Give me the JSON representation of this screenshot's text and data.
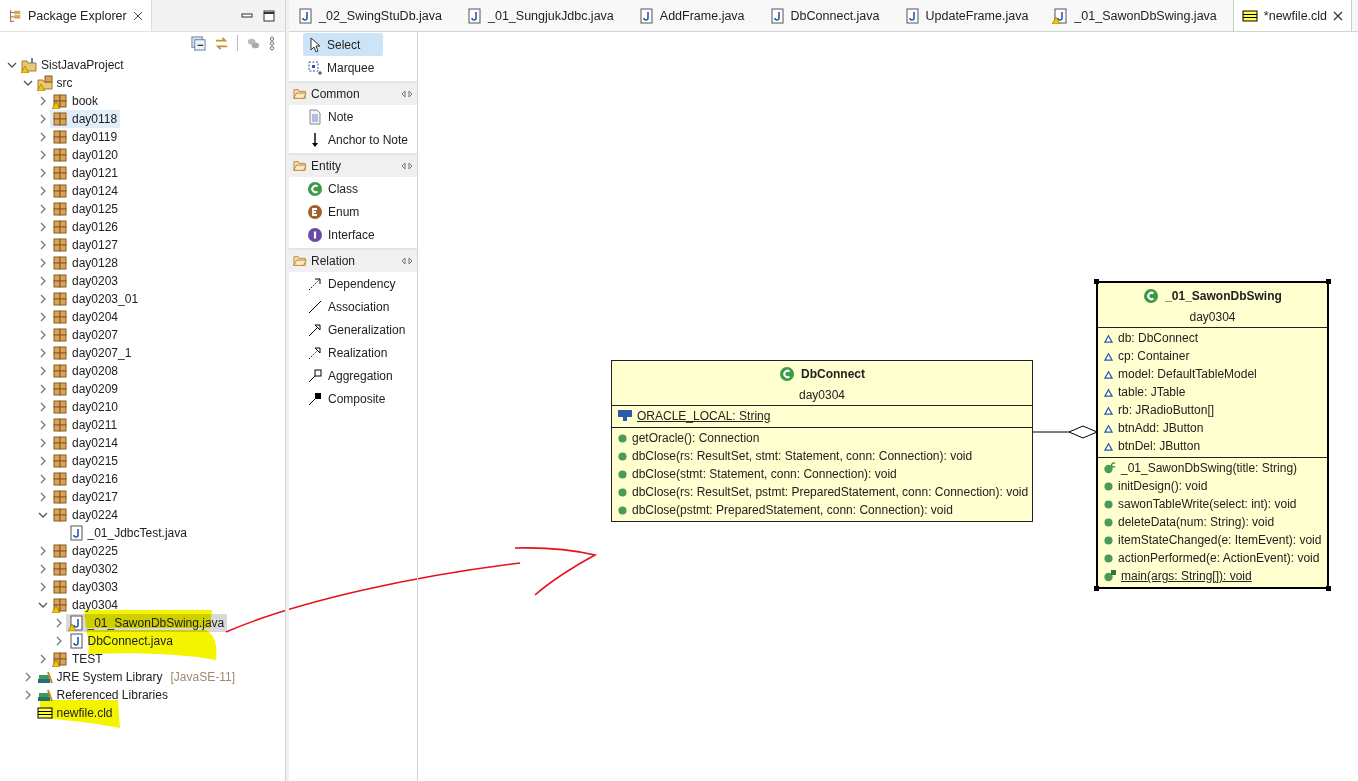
{
  "explorer": {
    "title": "Package Explorer",
    "tree": [
      {
        "label": "SistJavaProject",
        "kind": "project",
        "warning": true,
        "expanded": true,
        "selected": false,
        "hovered": false,
        "children": [
          {
            "label": "src",
            "kind": "source-folder",
            "warning": true,
            "expanded": true,
            "selected": false,
            "hovered": false,
            "children": [
              {
                "label": "book",
                "kind": "package",
                "warning": true,
                "expanded": false,
                "selected": false,
                "hovered": false
              },
              {
                "label": "day0118",
                "kind": "package",
                "warning": false,
                "expanded": false,
                "selected": false,
                "hovered": true
              },
              {
                "label": "day0119",
                "kind": "package",
                "warning": false,
                "expanded": false,
                "selected": false,
                "hovered": false
              },
              {
                "label": "day0120",
                "kind": "package",
                "warning": false,
                "expanded": false,
                "selected": false,
                "hovered": false
              },
              {
                "label": "day0121",
                "kind": "package",
                "warning": false,
                "expanded": false,
                "selected": false,
                "hovered": false
              },
              {
                "label": "day0124",
                "kind": "package",
                "warning": false,
                "expanded": false,
                "selected": false,
                "hovered": false
              },
              {
                "label": "day0125",
                "kind": "package",
                "warning": false,
                "expanded": false,
                "selected": false,
                "hovered": false
              },
              {
                "label": "day0126",
                "kind": "package",
                "warning": false,
                "expanded": false,
                "selected": false,
                "hovered": false
              },
              {
                "label": "day0127",
                "kind": "package",
                "warning": false,
                "expanded": false,
                "selected": false,
                "hovered": false
              },
              {
                "label": "day0128",
                "kind": "package",
                "warning": false,
                "expanded": false,
                "selected": false,
                "hovered": false
              },
              {
                "label": "day0203",
                "kind": "package",
                "warning": false,
                "expanded": false,
                "selected": false,
                "hovered": false
              },
              {
                "label": "day0203_01",
                "kind": "package",
                "warning": false,
                "expanded": false,
                "selected": false,
                "hovered": false
              },
              {
                "label": "day0204",
                "kind": "package",
                "warning": false,
                "expanded": false,
                "selected": false,
                "hovered": false
              },
              {
                "label": "day0207",
                "kind": "package",
                "warning": false,
                "expanded": false,
                "selected": false,
                "hovered": false
              },
              {
                "label": "day0207_1",
                "kind": "package",
                "warning": false,
                "expanded": false,
                "selected": false,
                "hovered": false
              },
              {
                "label": "day0208",
                "kind": "package",
                "warning": false,
                "expanded": false,
                "selected": false,
                "hovered": false
              },
              {
                "label": "day0209",
                "kind": "package",
                "warning": false,
                "expanded": false,
                "selected": false,
                "hovered": false
              },
              {
                "label": "day0210",
                "kind": "package",
                "warning": false,
                "expanded": false,
                "selected": false,
                "hovered": false
              },
              {
                "label": "day0211",
                "kind": "package",
                "warning": false,
                "expanded": false,
                "selected": false,
                "hovered": false
              },
              {
                "label": "day0214",
                "kind": "package",
                "warning": false,
                "expanded": false,
                "selected": false,
                "hovered": false
              },
              {
                "label": "day0215",
                "kind": "package",
                "warning": false,
                "expanded": false,
                "selected": false,
                "hovered": false
              },
              {
                "label": "day0216",
                "kind": "package",
                "warning": false,
                "expanded": false,
                "selected": false,
                "hovered": false
              },
              {
                "label": "day0217",
                "kind": "package",
                "warning": false,
                "expanded": false,
                "selected": false,
                "hovered": false
              },
              {
                "label": "day0224",
                "kind": "package",
                "warning": false,
                "expanded": true,
                "selected": false,
                "hovered": false,
                "children": [
                  {
                    "label": "_01_JdbcTest.java",
                    "kind": "java-file",
                    "warning": false,
                    "selected": false,
                    "hovered": false
                  }
                ]
              },
              {
                "label": "day0225",
                "kind": "package",
                "warning": false,
                "expanded": false,
                "selected": false,
                "hovered": false
              },
              {
                "label": "day0302",
                "kind": "package",
                "warning": false,
                "expanded": false,
                "selected": false,
                "hovered": false
              },
              {
                "label": "day0303",
                "kind": "package",
                "warning": false,
                "expanded": false,
                "selected": false,
                "hovered": false
              },
              {
                "label": "day0304",
                "kind": "package",
                "warning": true,
                "expanded": true,
                "selected": false,
                "hovered": false,
                "children": [
                  {
                    "label": "_01_SawonDbSwing.java",
                    "kind": "java-file",
                    "warning": true,
                    "expanded": false,
                    "selected": true,
                    "hovered": false
                  },
                  {
                    "label": "DbConnect.java",
                    "kind": "java-file",
                    "warning": false,
                    "expanded": false,
                    "selected": false,
                    "hovered": false
                  }
                ]
              },
              {
                "label": "TEST",
                "kind": "package",
                "warning": true,
                "expanded": false,
                "selected": false,
                "hovered": false
              }
            ]
          },
          {
            "label": "JRE System Library",
            "decoration": "[JavaSE-11]",
            "kind": "library",
            "warning": false,
            "expanded": false,
            "selected": false,
            "hovered": false
          },
          {
            "label": "Referenced Libraries",
            "kind": "library",
            "warning": false,
            "expanded": false,
            "selected": false,
            "hovered": false
          },
          {
            "label": "newfile.cld",
            "kind": "cld-file",
            "warning": false,
            "selected": false,
            "hovered": false
          }
        ]
      }
    ]
  },
  "editor_tabs": [
    {
      "label": "_02_SwingStuDb.java",
      "kind": "java",
      "warning": false,
      "selected": false
    },
    {
      "label": "_01_SungjukJdbc.java",
      "kind": "java",
      "warning": false,
      "selected": false
    },
    {
      "label": "AddFrame.java",
      "kind": "java",
      "warning": false,
      "selected": false
    },
    {
      "label": "DbConnect.java",
      "kind": "java",
      "warning": false,
      "selected": false
    },
    {
      "label": "UpdateFrame.java",
      "kind": "java",
      "warning": false,
      "selected": false
    },
    {
      "label": "_01_SawonDbSwing.java",
      "kind": "java",
      "warning": true,
      "selected": false
    },
    {
      "label": "*newfile.cld",
      "kind": "cld",
      "warning": false,
      "selected": true
    }
  ],
  "palette": {
    "tools": [
      {
        "label": "Select",
        "kind": "select",
        "selected": true
      },
      {
        "label": "Marquee",
        "kind": "marquee",
        "selected": false
      }
    ],
    "groups": [
      {
        "title": "Common",
        "items": [
          {
            "label": "Note",
            "kind": "note"
          },
          {
            "label": "Anchor to Note",
            "kind": "anchor"
          }
        ]
      },
      {
        "title": "Entity",
        "items": [
          {
            "label": "Class",
            "kind": "class"
          },
          {
            "label": "Enum",
            "kind": "enum"
          },
          {
            "label": "Interface",
            "kind": "interface"
          }
        ]
      },
      {
        "title": "Relation",
        "items": [
          {
            "label": "Dependency",
            "kind": "dependency"
          },
          {
            "label": "Association",
            "kind": "association"
          },
          {
            "label": "Generalization",
            "kind": "generalization"
          },
          {
            "label": "Realization",
            "kind": "realization"
          },
          {
            "label": "Aggregation",
            "kind": "aggregation"
          },
          {
            "label": "Composite",
            "kind": "composite"
          }
        ]
      }
    ]
  },
  "classes": [
    {
      "name": "DbConnect",
      "package": "day0304",
      "selected": false,
      "attributes": [
        {
          "text": "ORACLE_LOCAL: String",
          "kind": "static-final",
          "static": true
        }
      ],
      "methods": [
        {
          "text": "getOracle(): Connection",
          "kind": "public",
          "static": false
        },
        {
          "text": "dbClose(rs: ResultSet, stmt: Statement, conn: Connection): void",
          "kind": "public",
          "static": false
        },
        {
          "text": "dbClose(stmt: Statement, conn: Connection): void",
          "kind": "public",
          "static": false
        },
        {
          "text": "dbClose(rs: ResultSet, pstmt: PreparedStatement, conn: Connection): void",
          "kind": "public",
          "static": false
        },
        {
          "text": "dbClose(pstmt: PreparedStatement, conn: Connection): void",
          "kind": "public",
          "static": false
        }
      ]
    },
    {
      "name": "_01_SawonDbSwing",
      "package": "day0304",
      "selected": true,
      "attributes": [
        {
          "text": "db: DbConnect",
          "kind": "package",
          "static": false
        },
        {
          "text": "cp: Container",
          "kind": "package",
          "static": false
        },
        {
          "text": "model: DefaultTableModel",
          "kind": "package",
          "static": false
        },
        {
          "text": "table: JTable",
          "kind": "package",
          "static": false
        },
        {
          "text": "rb: JRadioButton[]",
          "kind": "package",
          "static": false
        },
        {
          "text": "btnAdd: JButton",
          "kind": "package",
          "static": false
        },
        {
          "text": "btnDel: JButton",
          "kind": "package",
          "static": false
        }
      ],
      "methods": [
        {
          "text": "_01_SawonDbSwing(title: String)",
          "kind": "constructor",
          "static": false
        },
        {
          "text": "initDesign(): void",
          "kind": "public",
          "static": false
        },
        {
          "text": "sawonTableWrite(select: int): void",
          "kind": "public",
          "static": false
        },
        {
          "text": "deleteData(num: String): void",
          "kind": "public",
          "static": false
        },
        {
          "text": "itemStateChanged(e: ItemEvent): void",
          "kind": "public",
          "static": false
        },
        {
          "text": "actionPerformed(e: ActionEvent): void",
          "kind": "public",
          "static": false
        },
        {
          "text": "main(args: String[]): void",
          "kind": "static",
          "static": true
        }
      ]
    }
  ],
  "relations": [
    {
      "kind": "aggregation"
    }
  ]
}
